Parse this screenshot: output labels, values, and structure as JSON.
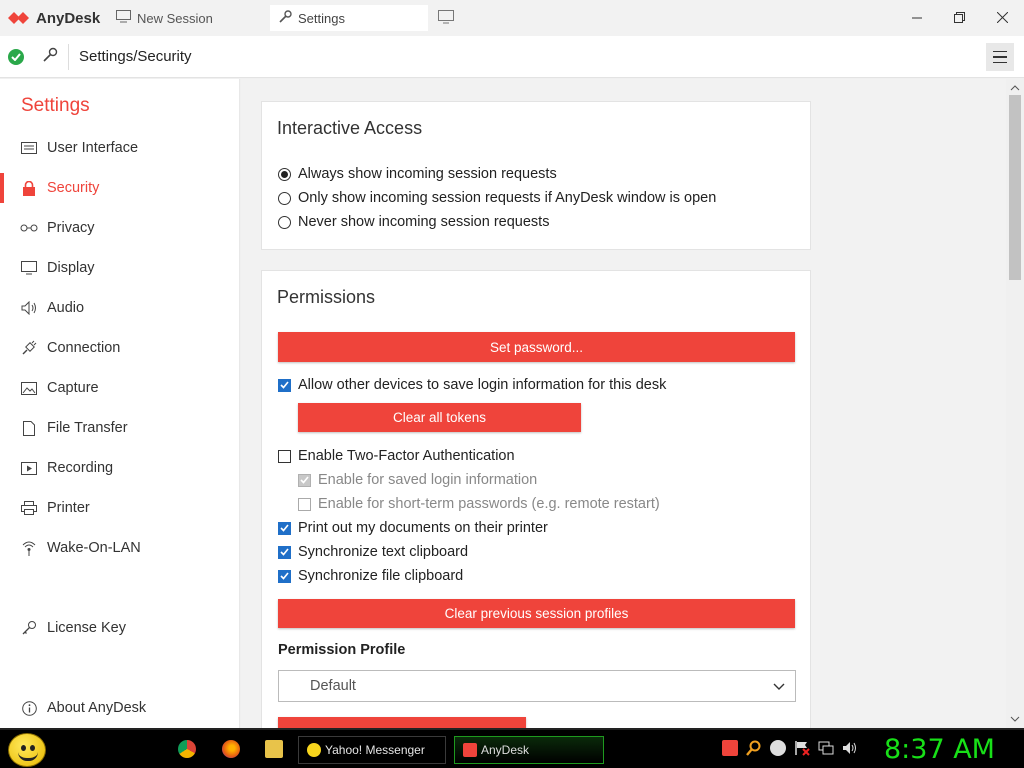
{
  "app": {
    "name": "AnyDesk",
    "brand_color": "#ef443b"
  },
  "tabs": [
    {
      "label": "New Session",
      "icon": "monitor-icon"
    },
    {
      "label": "Settings",
      "icon": "wrench-icon",
      "active": true
    }
  ],
  "address": {
    "status_icon": "connected-check-icon",
    "path": "Settings/Security"
  },
  "sidebar": {
    "title": "Settings",
    "items": [
      {
        "label": "User Interface",
        "icon": "keyboard-icon"
      },
      {
        "label": "Security",
        "icon": "lock-icon",
        "active": true
      },
      {
        "label": "Privacy",
        "icon": "glasses-icon"
      },
      {
        "label": "Display",
        "icon": "display-icon"
      },
      {
        "label": "Audio",
        "icon": "speaker-icon"
      },
      {
        "label": "Connection",
        "icon": "plug-icon"
      },
      {
        "label": "Capture",
        "icon": "image-icon"
      },
      {
        "label": "File Transfer",
        "icon": "file-icon"
      },
      {
        "label": "Recording",
        "icon": "play-icon"
      },
      {
        "label": "Printer",
        "icon": "printer-icon"
      },
      {
        "label": "Wake-On-LAN",
        "icon": "wifi-icon"
      },
      {
        "label": "License Key",
        "icon": "key-icon"
      },
      {
        "label": "About AnyDesk",
        "icon": "info-icon"
      }
    ]
  },
  "interactive_access": {
    "title": "Interactive Access",
    "options": [
      {
        "label": "Always show incoming session requests",
        "selected": true
      },
      {
        "label": "Only show incoming session requests if AnyDesk window is open",
        "selected": false
      },
      {
        "label": "Never show incoming session requests",
        "selected": false
      }
    ]
  },
  "permissions": {
    "title": "Permissions",
    "set_password_label": "Set password...",
    "allow_save_login_label": "Allow other devices to save login information for this desk",
    "allow_save_login_checked": true,
    "clear_tokens_label": "Clear all tokens",
    "two_factor_label": "Enable Two-Factor Authentication",
    "two_factor_checked": false,
    "saved_login_label": "Enable for saved login information",
    "saved_login_checked": true,
    "short_term_label": "Enable for short-term passwords (e.g. remote restart)",
    "short_term_checked": false,
    "print_label": "Print out my documents on their printer",
    "print_checked": true,
    "sync_text_label": "Synchronize text clipboard",
    "sync_text_checked": true,
    "sync_file_label": "Synchronize file clipboard",
    "sync_file_checked": true,
    "clear_profiles_label": "Clear previous session profiles",
    "profile_label": "Permission Profile",
    "profile_value": "Default"
  },
  "taskbar": {
    "tasks": [
      {
        "label": "Yahoo! Messenger",
        "icon": "yahoo-messenger-icon"
      },
      {
        "label": "AnyDesk",
        "icon": "anydesk-icon",
        "active": true
      }
    ],
    "clock": "8:37 AM"
  }
}
